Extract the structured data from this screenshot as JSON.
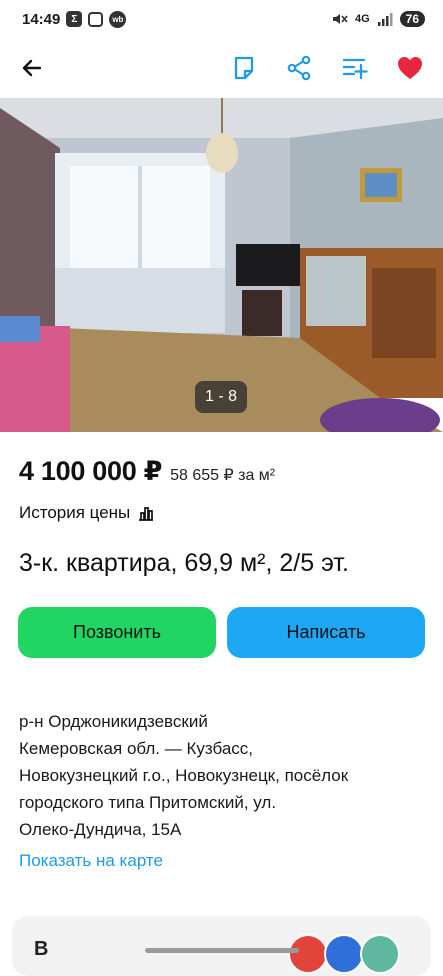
{
  "status_bar": {
    "time": "14:49",
    "notif_icons": [
      "sigma-icon",
      "instagram-icon",
      "wb-icon"
    ],
    "wb_text": "wb",
    "network": "4G",
    "battery": "76"
  },
  "toolbar": {
    "icons": [
      "back-arrow-icon",
      "note-icon",
      "share-icon",
      "compare-icon",
      "heart-icon"
    ],
    "accent": "#1e9be8",
    "favorite_color": "#e8263e"
  },
  "gallery": {
    "counter": "1 - 8"
  },
  "listing": {
    "price": "4 100 000 ₽",
    "price_per_m2": "58 655 ₽ за м²",
    "price_history": "История цены",
    "title": "3-к. квартира, 69,9 м², 2/5 эт."
  },
  "actions": {
    "call": "Позвонить",
    "message": "Написать",
    "call_color": "#20d561",
    "message_color": "#1ea7f5"
  },
  "address": {
    "lines": [
      "р-н Орджоникидзевский",
      "Кемеровская обл. — Кузбасс,",
      "Новокузнецкий г.о., Новокузнецк, посёлок",
      "городского типа Притомский, ул.",
      "Олеко-Дундича, 15А"
    ],
    "map_link": "Показать на карте"
  },
  "next_card": {
    "letter": "В"
  }
}
